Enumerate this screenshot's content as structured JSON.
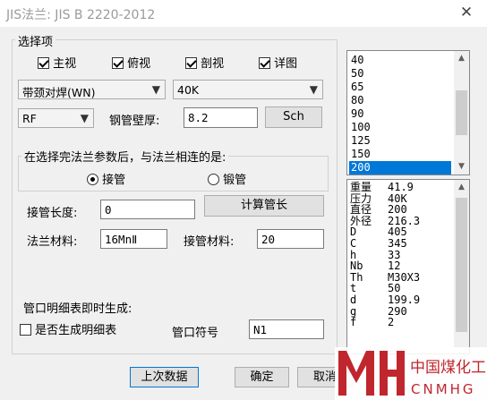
{
  "window": {
    "title": "JIS法兰: JIS B 2220-2012"
  },
  "options": {
    "group_title": "选择项",
    "views": [
      {
        "label": "主视",
        "checked": true
      },
      {
        "label": "俯视",
        "checked": true
      },
      {
        "label": "剖视",
        "checked": true
      },
      {
        "label": "详图",
        "checked": true
      }
    ],
    "flange_type": "带颈对焊(WN)",
    "pressure": "40K",
    "face": "RF",
    "wall_label": "钢管壁厚:",
    "wall_value": "8.2",
    "sch_label": "Sch"
  },
  "connect": {
    "legend": "在选择完法兰参数后，与法兰相连的是:",
    "options": [
      {
        "label": "接管",
        "selected": true
      },
      {
        "label": "锻管",
        "selected": false
      }
    ]
  },
  "pipe": {
    "length_label": "接管长度:",
    "length_value": "0",
    "calc_label": "计算管长",
    "flange_material_label": "法兰材料:",
    "flange_material_value": "16MnⅡ",
    "pipe_material_label": "接管材料:",
    "pipe_material_value": "20"
  },
  "nozzle": {
    "group_title": "管口明细表即时生成:",
    "generate_label": "是否生成明细表",
    "generate_checked": false,
    "symbol_label": "管口符号",
    "symbol_value": "N1"
  },
  "buttons": {
    "last": "上次数据",
    "ok": "确定",
    "cancel": "取消"
  },
  "size_list": {
    "items": [
      "40",
      "50",
      "65",
      "80",
      "90",
      "100",
      "125",
      "150",
      "200"
    ],
    "selected": "200"
  },
  "info_list": [
    {
      "key": "重量",
      "value": "41.9"
    },
    {
      "key": "压力",
      "value": "40K"
    },
    {
      "key": "直径",
      "value": "200"
    },
    {
      "key": "外径",
      "value": "216.3"
    },
    {
      "key": "D",
      "value": "405"
    },
    {
      "key": "C",
      "value": "345"
    },
    {
      "key": "h",
      "value": "33"
    },
    {
      "key": "Nb",
      "value": "12"
    },
    {
      "key": "Th",
      "value": "M30X3"
    },
    {
      "key": "t",
      "value": "50"
    },
    {
      "key": "d",
      "value": "199.9"
    },
    {
      "key": "g",
      "value": "290"
    },
    {
      "key": "f",
      "value": "2"
    }
  ],
  "watermark": {
    "cn": "中国煤化工",
    "en": "CNMHG"
  },
  "colors": {
    "accent": "#0078d7",
    "watermark": "#c0262d"
  },
  "icons": {
    "close": "close-icon",
    "dropdown": "chevron-down-icon"
  }
}
